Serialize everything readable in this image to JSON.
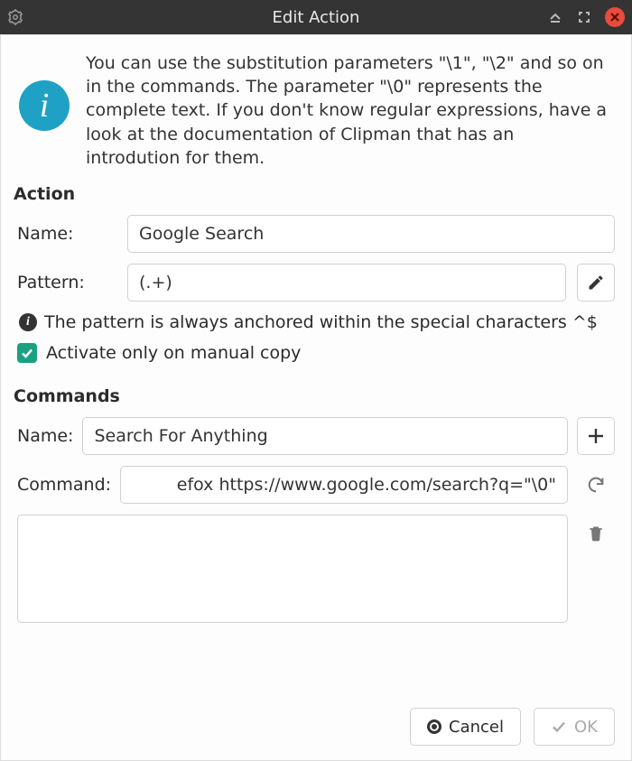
{
  "window": {
    "title": "Edit Action"
  },
  "info": {
    "badge_letter": "i",
    "text": "You can use the substitution parameters \"\\1\", \"\\2\" and so on in the commands. The parameter \"\\0\" represents the complete text. If you don't know regular expressions, have a look at the documentation of Clipman that has an introdution for them."
  },
  "action": {
    "section_label": "Action",
    "name_label": "Name:",
    "name_value": "Google Search",
    "pattern_label": "Pattern:",
    "pattern_value": "(.+)",
    "pattern_hint": "The pattern is always anchored within the special characters ^$",
    "checkbox_label": "Activate only on manual copy",
    "checkbox_checked": true
  },
  "commands": {
    "section_label": "Commands",
    "name_label": "Name:",
    "name_value": "Search For Anything",
    "command_label": "Command:",
    "command_value": "efox https://www.google.com/search?q=\"\\0\""
  },
  "buttons": {
    "cancel": "Cancel",
    "ok": "OK"
  },
  "colors": {
    "accent": "#1aa082",
    "info_badge": "#1ea1c4",
    "close_btn": "#e74c3c"
  }
}
